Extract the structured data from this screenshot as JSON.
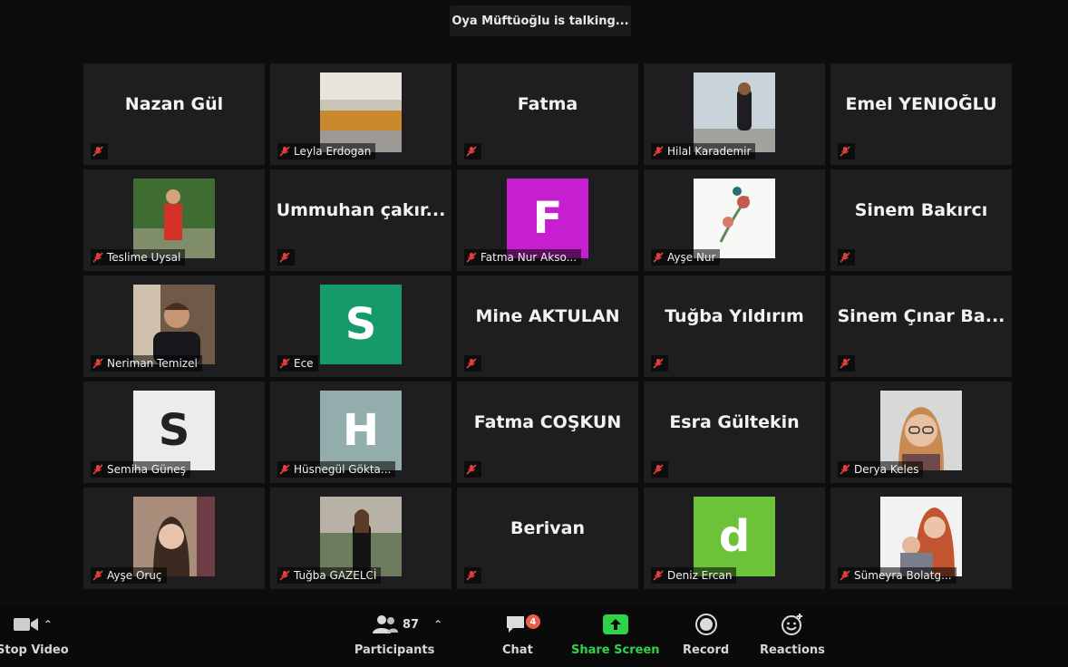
{
  "speaker_banner": "Oya Müftüoğlu is talking...",
  "tiles": [
    {
      "name": "Nazan Gül",
      "kind": "name"
    },
    {
      "name": "Leyla Erdogan",
      "kind": "photo",
      "photo": "group"
    },
    {
      "name": "Fatma",
      "kind": "name"
    },
    {
      "name": "Hilal Karademir",
      "kind": "photo",
      "photo": "sky"
    },
    {
      "name": "Emel YENIOĞLU",
      "kind": "name"
    },
    {
      "name": "Teslime Uysal",
      "kind": "photo",
      "photo": "garden"
    },
    {
      "name": "Ummuhan çakır...",
      "kind": "name"
    },
    {
      "name": "Fatma Nur Akso...",
      "kind": "letter",
      "letter": "F",
      "color": "#c51fd0"
    },
    {
      "name": "Ayşe Nur",
      "kind": "photo",
      "photo": "flower"
    },
    {
      "name": "Sinem Bakırcı",
      "kind": "name"
    },
    {
      "name": "Neriman Temizel",
      "kind": "photo",
      "photo": "portrait-dark"
    },
    {
      "name": "Ece",
      "kind": "letter",
      "letter": "S",
      "color": "#159a6a"
    },
    {
      "name": "Mine AKTULAN",
      "kind": "name"
    },
    {
      "name": "Tuğba Yıldırım",
      "kind": "name"
    },
    {
      "name": "Sinem Çınar Ba...",
      "kind": "name"
    },
    {
      "name": "Semiha Güneş",
      "kind": "letter",
      "letter": "S",
      "color": "#ececec",
      "letter_color": "#222"
    },
    {
      "name": "Hüsnegül Gökta...",
      "kind": "letter",
      "letter": "H",
      "color": "#93adad"
    },
    {
      "name": "Fatma COŞKUN",
      "kind": "name"
    },
    {
      "name": "Esra Gültekin",
      "kind": "name"
    },
    {
      "name": "Derya Keles",
      "kind": "photo",
      "photo": "glasses"
    },
    {
      "name": "Ayşe Oruç",
      "kind": "photo",
      "photo": "selfie"
    },
    {
      "name": "Tuğba GAZELCİ",
      "kind": "photo",
      "photo": "standing"
    },
    {
      "name": "Berivan",
      "kind": "name"
    },
    {
      "name": "Deniz Ercan",
      "kind": "letter",
      "letter": "d",
      "color": "#6cc33a"
    },
    {
      "name": "Sümeyra Bolatg...",
      "kind": "photo",
      "photo": "mother"
    }
  ],
  "toolbar": {
    "stop_video": "Stop Video",
    "participants_count": "87",
    "participants": "Participants",
    "chat": "Chat",
    "chat_badge": "4",
    "share_screen": "Share Screen",
    "record": "Record",
    "reactions": "Reactions"
  },
  "colors": {
    "share_green": "#2fd34a",
    "mute_red": "#e0413b"
  }
}
